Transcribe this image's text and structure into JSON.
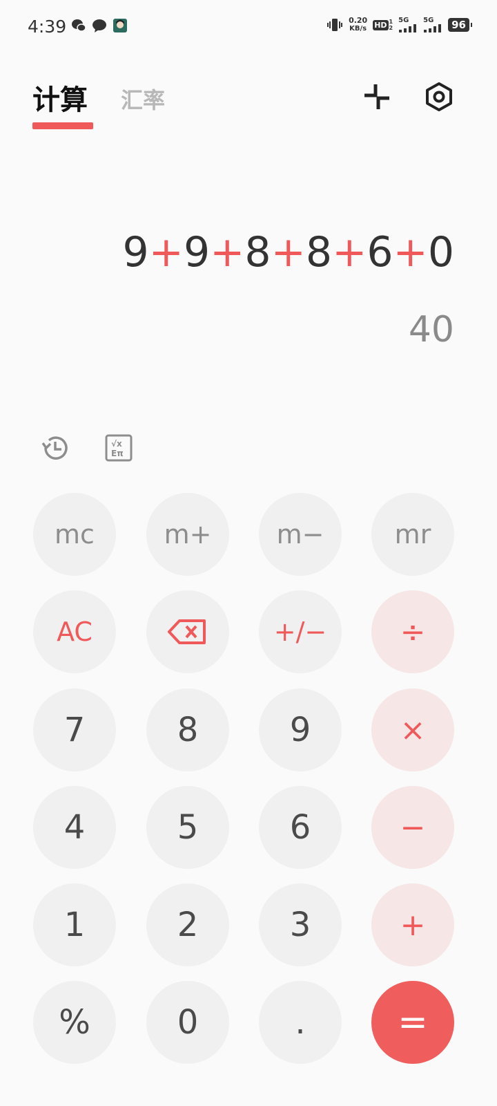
{
  "status_bar": {
    "time": "4:39",
    "net_speed_value": "0.20",
    "net_speed_unit": "KB/s",
    "network": "5G",
    "network2": "5G",
    "hd_label": "HD",
    "battery": "96"
  },
  "tabs": {
    "calculate": "计算",
    "exchange_rate": "汇率"
  },
  "display": {
    "expression_tokens": [
      "9",
      "+",
      "9",
      "+",
      "8",
      "+",
      "8",
      "+",
      "6",
      "+",
      "0"
    ],
    "result": "40"
  },
  "keys": {
    "mc": "mc",
    "mplus": "m+",
    "mminus": "m−",
    "mr": "mr",
    "ac": "AC",
    "plusminus": "+/−",
    "divide": "÷",
    "seven": "7",
    "eight": "8",
    "nine": "9",
    "multiply": "×",
    "four": "4",
    "five": "5",
    "six": "6",
    "minus": "−",
    "one": "1",
    "two": "2",
    "three": "3",
    "plus": "+",
    "percent": "%",
    "zero": "0",
    "dot": ".",
    "equals": "="
  },
  "colors": {
    "accent": "#f0595a",
    "key_bg": "#f0f0f0",
    "op_key_bg": "#f7e6e6"
  }
}
